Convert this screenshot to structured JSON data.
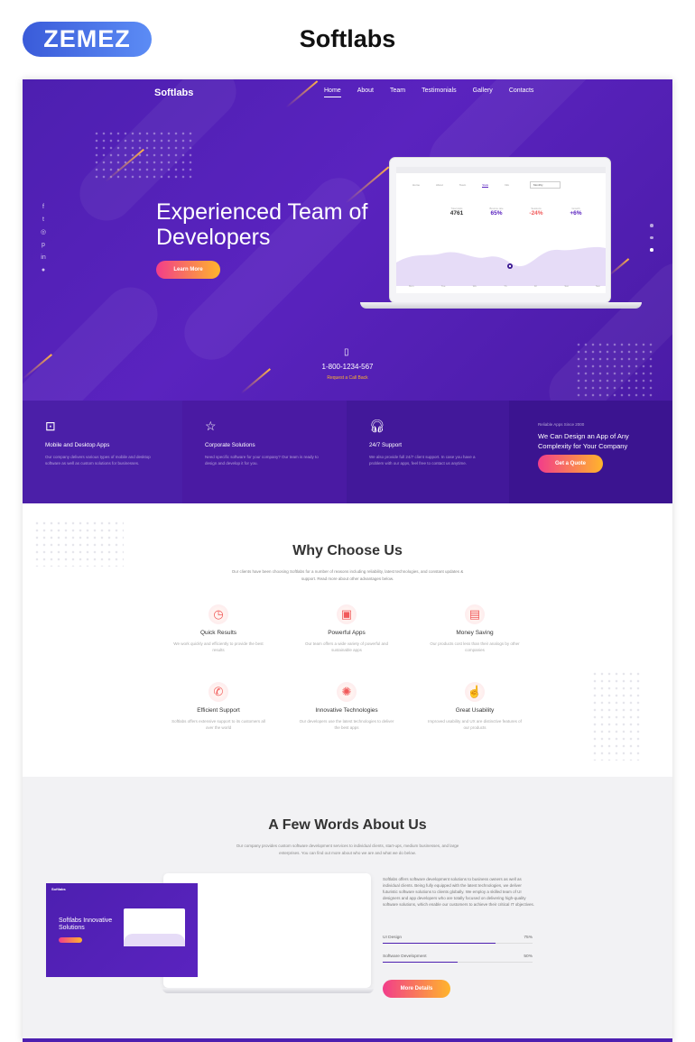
{
  "header": {
    "badge": "ZEMEZ",
    "title": "Softlabs"
  },
  "colors": {
    "purple": "#5a23bf",
    "gradient_start": "#f23d8a",
    "gradient_end": "#ffb52c",
    "accent_line": "#ffb347"
  },
  "site": {
    "brand": "Softlabs",
    "nav": [
      "Home",
      "About",
      "Team",
      "Testimonials",
      "Gallery",
      "Contacts"
    ],
    "social_icons": [
      "facebook-icon",
      "twitter-icon",
      "instagram-icon",
      "pinterest-icon",
      "linkedin-icon",
      "user-icon"
    ]
  },
  "hero": {
    "title_line1": "Experienced Team of",
    "title_line2": "Developers",
    "button": "Learn More",
    "phone": "1-800-1234-567",
    "callback": "Request a Call Back",
    "screen": {
      "nav": [
        "Home",
        "About",
        "Team",
        "Stats",
        "Info"
      ],
      "dropdown": "Monthly",
      "stats": [
        {
          "label": "Total visits",
          "value": "4761",
          "color": "#333333"
        },
        {
          "label": "Bounce rate",
          "value": "65%",
          "color": "#5a23bf"
        },
        {
          "label": "Sessions",
          "value": "-24%",
          "color": "#f15a5a"
        },
        {
          "label": "Growth",
          "value": "+6%",
          "color": "#5a23bf"
        }
      ],
      "days": [
        "Mon",
        "Tue",
        "We",
        "Th",
        "Fri",
        "Sat",
        "Sun"
      ]
    }
  },
  "features": [
    {
      "icon": "laptop-icon",
      "title": "Mobile and Desktop Apps",
      "desc": "Our company delivers various types of mobile and desktop software as well as custom solutions for businesses."
    },
    {
      "icon": "star-icon",
      "title": "Corporate Solutions",
      "desc": "Need specific software for your company? Our team is ready to design and develop it for you."
    },
    {
      "icon": "headset-icon",
      "title": "24/7 Support",
      "desc": "We also provide full 24/7 client support. In case you have a problem with our apps, feel free to contact us anytime."
    }
  ],
  "cta": {
    "small": "Reliable Apps Since 2000",
    "title": "We Can Design an App of Any Complexity for Your Company",
    "button": "Get a Quote"
  },
  "why": {
    "title": "Why Choose Us",
    "subtitle": "Our clients have been choosing Softlabs for a number of reasons including reliability, latest technologies, and constant updates & support. Read more about other advantages below.",
    "items": [
      {
        "icon": "clock-icon",
        "title": "Quick Results",
        "desc": "We work quickly and efficiently to provide the best results"
      },
      {
        "icon": "image-app-icon",
        "title": "Powerful Apps",
        "desc": "Our team offers a wide variety of powerful and sustainable apps"
      },
      {
        "icon": "money-icon",
        "title": "Money Saving",
        "desc": "Our products cost less than their analogs by other companies"
      },
      {
        "icon": "support-icon",
        "title": "Efficient Support",
        "desc": "Softlabs offers extensive support to its customers all over the world"
      },
      {
        "icon": "lightbulb-icon",
        "title": "Innovative Technologies",
        "desc": "Our developers use the latest technologies to deliver the best apps"
      },
      {
        "icon": "hand-pointer-icon",
        "title": "Great Usability",
        "desc": "Improved usability and UX are distinctive features of our products"
      }
    ]
  },
  "about": {
    "title": "A Few Words About Us",
    "subtitle": "Our company provides custom software development services to individual clients, start-ups, medium businesses, and large enterprises. You can find out more about who we are and what we do below.",
    "mock_brand": "Softlabs",
    "mock_title": "Softlabs Innovative Solutions",
    "paragraph": "Softlabs offers software development solutions to business owners as well as individual clients. Being fully equipped with the latest technologies, we deliver futuristic software solutions to clients globally. We employ a skilled team of UI designers and app developers who are totally focused on delivering high-quality software solutions, which enable our customers to achieve their critical IT objectives.",
    "skills": [
      {
        "label": "UI Design",
        "percent": "75%",
        "value": 0.75
      },
      {
        "label": "Software Development",
        "percent": "50%",
        "value": 0.5
      }
    ],
    "button": "More Details"
  }
}
